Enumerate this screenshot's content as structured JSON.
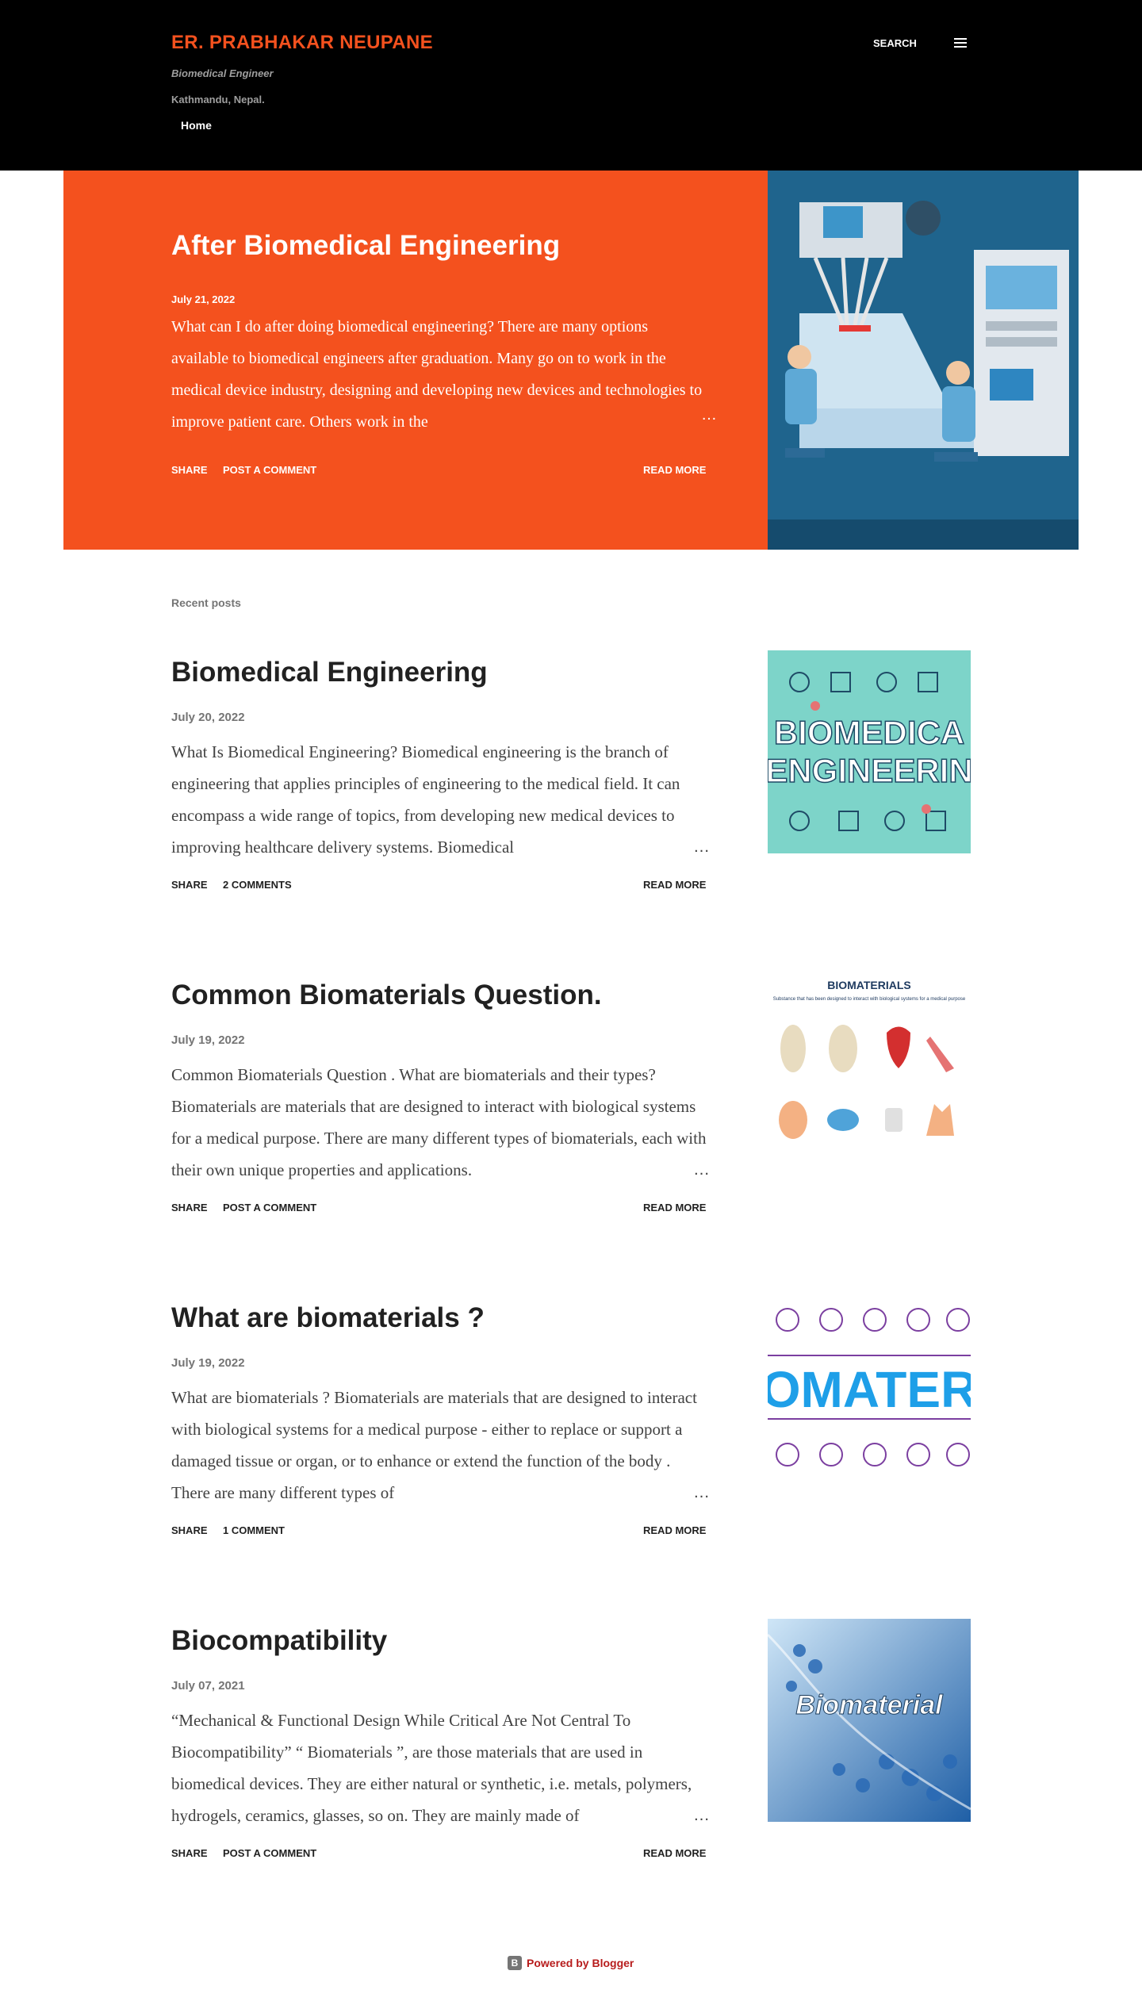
{
  "header": {
    "title": "ER. PRABHAKAR NEUPANE",
    "description": "Biomedical Engineer",
    "location": "Kathmandu, Nepal.",
    "nav_home": "Home",
    "search_label": "SEARCH"
  },
  "featured": {
    "title": "After Biomedical Engineering",
    "date": "July 21, 2022",
    "snippet": "What can I do after doing biomedical engineering? There are many options available to biomedical engineers after graduation. Many go on to work in the medical device industry, designing and developing new devices and technologies to improve patient care. Others work in the",
    "ellipsis": "…",
    "share": "SHARE",
    "comments": "POST A COMMENT",
    "read_more": "READ MORE"
  },
  "recent_label": "Recent posts",
  "posts": [
    {
      "title": "Biomedical Engineering",
      "date": "July 20, 2022",
      "snippet": "What Is Biomedical Engineering? Biomedical engineering is the branch of engineering that applies principles of engineering to the medical field. It can encompass a wide range of topics, from developing new medical devices to improving healthcare delivery systems. Biomedical",
      "ellipsis": "…",
      "share": "SHARE",
      "comments": "2 COMMENTS",
      "read_more": "READ MORE",
      "thumb_text_1": "BIOMEDICA",
      "thumb_text_2": "ENGINEERIN"
    },
    {
      "title": "Common Biomaterials Question.",
      "date": "July 19, 2022",
      "snippet": "Common Biomaterials Question . What are biomaterials and their types?   Biomaterials are materials that are designed to interact with biological systems for a medical purpose. There are many different types of biomaterials, each with their own unique properties and applications.",
      "ellipsis": "…",
      "share": "SHARE",
      "comments": "POST A COMMENT",
      "read_more": "READ MORE",
      "thumb_text_1": "BIOMATERIALS",
      "thumb_text_2": "Substance that has been designed to interact with biological systems for a medical purpose"
    },
    {
      "title": "What are biomaterials ?",
      "date": "July 19, 2022",
      "snippet": "  What are biomaterials ? Biomaterials  are materials that are designed to interact with biological systems for a medical purpose - either to replace or support a damaged tissue or organ, or to enhance or extend the function of the body .  There are many different types of",
      "ellipsis": "…",
      "share": "SHARE",
      "comments": "1 COMMENT",
      "read_more": "READ MORE",
      "thumb_text_1": "OMATER",
      "thumb_text_2": ""
    },
    {
      "title": "Biocompatibility",
      "date": "July 07, 2021",
      "snippet": "  “Mechanical & Functional Design While Critical Are Not Central To Biocompatibility” “ Biomaterials ”, are those materials that are used in biomedical devices. They are either natural or synthetic, i.e. metals, polymers, hydrogels, ceramics, glasses, so on. They are mainly made of",
      "ellipsis": "…",
      "share": "SHARE",
      "comments": "POST A COMMENT",
      "read_more": "READ MORE",
      "thumb_text_1": "Biomaterial",
      "thumb_text_2": ""
    }
  ],
  "footer": {
    "powered_by": "Powered by Blogger",
    "icon_letter": "B"
  },
  "colors": {
    "accent": "#f4511e",
    "header_bg": "#000000",
    "text": "#212121",
    "muted": "#757575",
    "footer_link": "#b71c1c"
  }
}
